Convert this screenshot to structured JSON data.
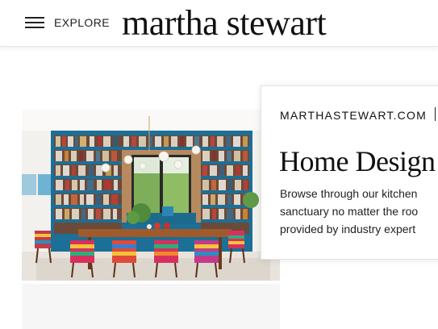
{
  "header": {
    "menu_icon": "hamburger-menu-icon",
    "explore_label": "EXPLORE",
    "logo_text": "martha stewart"
  },
  "article_card": {
    "source": "MARTHASTEWART.COM",
    "title": "Home Design",
    "description_lines": [
      "Browse through our kitchen",
      "sanctuary no matter the roo",
      "provided by industry expert"
    ]
  },
  "colors": {
    "bookshelf": "#1c6f96",
    "header_border": "#e6e6e6",
    "text": "#111111"
  }
}
